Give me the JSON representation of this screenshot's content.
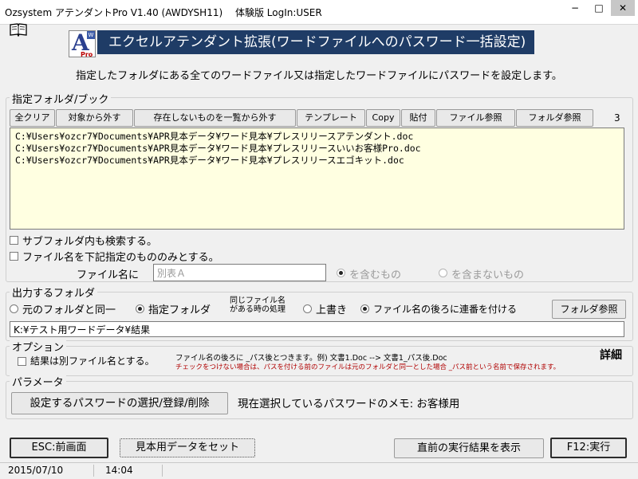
{
  "window": {
    "title": "Ozsystem アテンダントPro V1.40 (AWDYSH11)　 体験版 LogIn:USER",
    "minimize": "−",
    "maximize": "□",
    "close": "✕"
  },
  "header": {
    "banner": "エクセルアテンダント拡張(ワードファイルへのパスワード一括設定)",
    "logo_letter": "A",
    "logo_tag": "W",
    "logo_pro": "Pro",
    "description": "指定したフォルダにある全てのワードファイル又は指定したワードファイルにパスワードを設定します。"
  },
  "folder_group": {
    "legend": "指定フォルダ/ブック",
    "buttons": {
      "clear_all": "全クリア",
      "exclude_target": "対象から外す",
      "exclude_missing": "存在しないものを一覧から外す",
      "template": "テンプレート",
      "copy": "Copy",
      "paste": "貼付",
      "file_browse": "ファイル参照",
      "folder_browse": "フォルダ参照"
    },
    "count": "3",
    "files": [
      "C:¥Users¥ozcr7¥Documents¥APR見本データ¥ワード見本¥プレスリリースアテンダント.doc",
      "C:¥Users¥ozcr7¥Documents¥APR見本データ¥ワード見本¥プレスリリースいいお客様Pro.doc",
      "C:¥Users¥ozcr7¥Documents¥APR見本データ¥ワード見本¥プレスリリースエゴキット.doc"
    ],
    "search_subfolders": "サブフォルダ内も検索する。",
    "filter_by_name": "ファイル名を下記指定のもののみとする。",
    "filename_label": "ファイル名に",
    "filename_value": "別表Ａ",
    "contains": "を含むもの",
    "not_contains": "を含まないもの"
  },
  "output_group": {
    "legend": "出力するフォルダ",
    "same_folder": "元のフォルダと同一",
    "specified_folder": "指定フォルダ",
    "same_name_line1": "同じファイル名",
    "same_name_line2": "がある時の処理",
    "overwrite": "上書き",
    "append_number": "ファイル名の後ろに連番を付ける",
    "folder_browse": "フォルダ参照",
    "path": "K:¥テスト用ワードデータ¥結果"
  },
  "option_group": {
    "legend": "オプション",
    "save_as_other": "結果は別ファイル名とする。",
    "note_line1": "ファイル名の後ろに _パス後とつきます。例) 文書1.Doc --> 文書1_パス後.Doc",
    "note_line2": "チェックをつけない場合は、パスを付ける前のファイルは元のフォルダと同一とした場合 _パス前という名前で保存されます。",
    "details": "詳細"
  },
  "param_group": {
    "legend": "パラメータ",
    "select_password": "設定するパスワードの選択/登録/削除",
    "memo": "現在選択しているパスワードのメモ: お客様用"
  },
  "footer": {
    "esc": "ESC:前画面",
    "sample_data": "見本用データをセット",
    "show_last_result": "直前の実行結果を表示",
    "run": "F12:実行"
  },
  "status": {
    "date": "2015/07/10",
    "time": "14:04"
  },
  "icons": {
    "menu": "book-icon"
  }
}
